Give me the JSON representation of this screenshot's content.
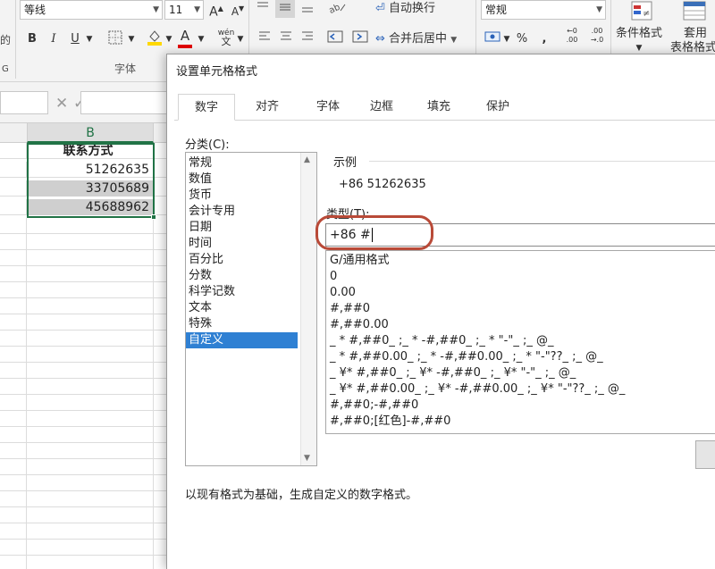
{
  "ribbon": {
    "font_name": "等线",
    "font_size": "11",
    "grow_font": "A",
    "shrink_font": "A",
    "bold": "B",
    "italic": "I",
    "underline": "U",
    "phonetic": "wén",
    "font_color_letter": "A",
    "wrap_text": "自动换行",
    "merge_center": "合并后居中",
    "number_format": "常规",
    "percent": "%",
    "comma": ",",
    "cond_format": "条件格式",
    "table_format_1": "套用",
    "table_format_2": "表格格式",
    "font_group": "字体",
    "left_cut": "的",
    "left_cut2": "G",
    "fill_color": "#ffd800",
    "font_color": "#e00000"
  },
  "formula_bar": {
    "cancel": "✕",
    "enter": "✓"
  },
  "sheet": {
    "column_header": "B",
    "header_text": "联系方式",
    "values": [
      "51262635",
      "33705689",
      "45688962"
    ]
  },
  "dialog": {
    "title": "设置单元格格式",
    "tabs": [
      "数字",
      "对齐",
      "字体",
      "边框",
      "填充",
      "保护"
    ],
    "category_label": "分类(C):",
    "categories": [
      "常规",
      "数值",
      "货币",
      "会计专用",
      "日期",
      "时间",
      "百分比",
      "分数",
      "科学记数",
      "文本",
      "特殊",
      "自定义"
    ],
    "selected_category": "自定义",
    "sample_label": "示例",
    "sample_value": "+86 51262635",
    "type_label": "类型(T):",
    "type_value": "+86 #",
    "formats": [
      "G/通用格式",
      "0",
      "0.00",
      "#,##0",
      "#,##0.00",
      "_ * #,##0_ ;_ * -#,##0_ ;_ * \"-\"_ ;_ @_",
      "_ * #,##0.00_ ;_ * -#,##0.00_ ;_ * \"-\"??_ ;_ @_",
      "_ ¥* #,##0_ ;_ ¥* -#,##0_ ;_ ¥* \"-\"_ ;_ @_",
      "_ ¥* #,##0.00_ ;_ ¥* -#,##0.00_ ;_ ¥* \"-\"??_ ;_ @_",
      "#,##0;-#,##0",
      "#,##0;[红色]-#,##0"
    ],
    "footnote": "以现有格式为基础，生成自定义的数字格式。"
  }
}
